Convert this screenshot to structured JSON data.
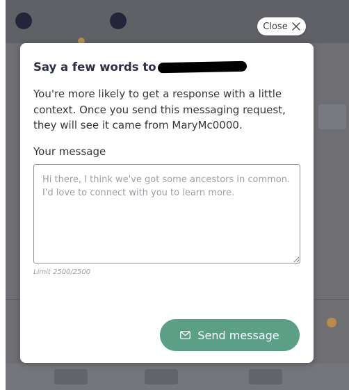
{
  "close": {
    "label": "Close",
    "icon": "close-x-icon"
  },
  "dialog": {
    "title": "Say a few words to",
    "intro": "You're more likely to get a response with a little context. Once you send this messaging request, they will see it came from MaryMc0000.",
    "message_label": "Your message",
    "message_value": "",
    "message_placeholder": "Hi there, I think we've got some ancestors in common. I'd love to connect with you to learn more.",
    "limit_text": "Limit 2500/2500",
    "send_label": "Send message",
    "send_icon": "envelope-icon"
  },
  "colors": {
    "accent": "#5a9f86",
    "title": "#2c2f45",
    "backdrop": "#6f6f73"
  }
}
